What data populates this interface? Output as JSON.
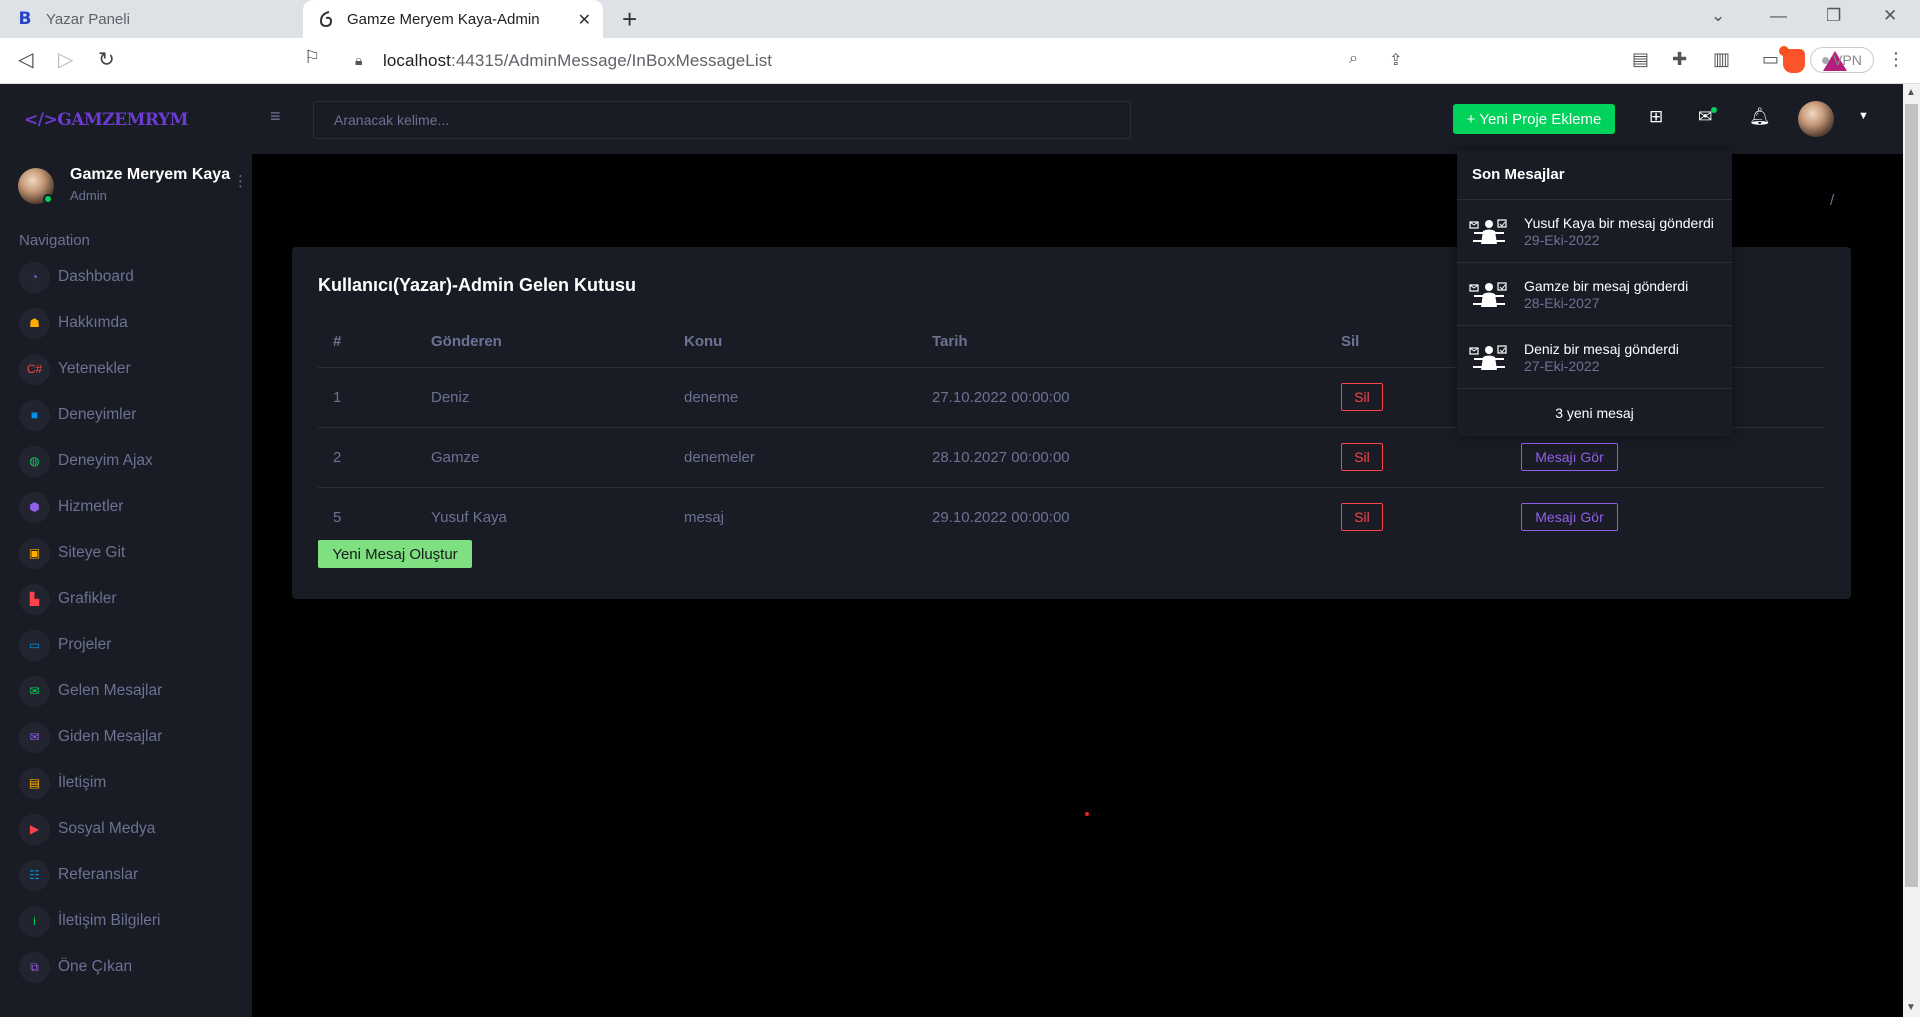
{
  "browser": {
    "tabs": [
      {
        "title": "Yazar Paneli",
        "active": false
      },
      {
        "title": "Gamze Meryem Kaya-Admin",
        "active": true
      }
    ],
    "url_host": "localhost",
    "url_rest": ":44315/AdminMessage/InBoxMessageList",
    "vpn_label": "VPN"
  },
  "sidebar": {
    "logo": "</>GAMZEMRYM",
    "profile": {
      "name": "Gamze Meryem Kaya",
      "role": "Admin"
    },
    "nav_title": "Navigation",
    "items": [
      {
        "label": "Dashboard",
        "icon": "speedometer-icon",
        "color": "#8f5fe8",
        "glyph": "◔"
      },
      {
        "label": "Hakkımda",
        "icon": "users-icon",
        "color": "#ffab00",
        "glyph": "☗"
      },
      {
        "label": "Yetenekler",
        "icon": "code-icon",
        "color": "#fc424a",
        "glyph": "C#"
      },
      {
        "label": "Deneyimler",
        "icon": "briefcase-icon",
        "color": "#0090e7",
        "glyph": "■"
      },
      {
        "label": "Deneyim Ajax",
        "icon": "globe-icon",
        "color": "#00d25b",
        "glyph": "◍"
      },
      {
        "label": "Hizmetler",
        "icon": "cube-icon",
        "color": "#8f5fe8",
        "glyph": "⬢"
      },
      {
        "label": "Siteye Git",
        "icon": "web-icon",
        "color": "#ffab00",
        "glyph": "▣"
      },
      {
        "label": "Grafikler",
        "icon": "chart-icon",
        "color": "#fc424a",
        "glyph": "▙"
      },
      {
        "label": "Projeler",
        "icon": "laptop-icon",
        "color": "#0090e7",
        "glyph": "▭"
      },
      {
        "label": "Gelen Mesajlar",
        "icon": "inbox-mail-icon",
        "color": "#00d25b",
        "glyph": "✉"
      },
      {
        "label": "Giden Mesajlar",
        "icon": "sent-mail-icon",
        "color": "#8f5fe8",
        "glyph": "✉"
      },
      {
        "label": "İletişim",
        "icon": "contact-card-icon",
        "color": "#ffab00",
        "glyph": "▤"
      },
      {
        "label": "Sosyal Medya",
        "icon": "youtube-icon",
        "color": "#fc424a",
        "glyph": "▶"
      },
      {
        "label": "Referanslar",
        "icon": "group-icon",
        "color": "#0090e7",
        "glyph": "☷"
      },
      {
        "label": "İletişim Bilgileri",
        "icon": "info-icon",
        "color": "#00d25b",
        "glyph": "i"
      },
      {
        "label": "Öne Çıkan",
        "icon": "featured-icon",
        "color": "#8f5fe8",
        "glyph": "⧉"
      }
    ]
  },
  "topbar": {
    "search_placeholder": "Aranacak kelime...",
    "new_project_label": "+ Yeni Proje Ekleme"
  },
  "breadcrumb_separator": "/",
  "card": {
    "title": "Kullanıcı(Yazar)-Admin Gelen Kutusu",
    "columns": [
      "#",
      "Gönderen",
      "Konu",
      "Tarih",
      "Sil",
      ""
    ],
    "rows": [
      {
        "id": "1",
        "sender": "Deniz",
        "subject": "deneme",
        "date": "27.10.2022 00:00:00",
        "delete_label": "Sil",
        "view_label": "Mesajı Gör"
      },
      {
        "id": "2",
        "sender": "Gamze",
        "subject": "denemeler",
        "date": "28.10.2027 00:00:00",
        "delete_label": "Sil",
        "view_label": "Mesajı Gör"
      },
      {
        "id": "5",
        "sender": "Yusuf Kaya",
        "subject": "mesaj",
        "date": "29.10.2022 00:00:00",
        "delete_label": "Sil",
        "view_label": "Mesajı Gör"
      }
    ],
    "new_message_label": "Yeni Mesaj Oluştur"
  },
  "messages_dropdown": {
    "title": "Son Mesajlar",
    "items": [
      {
        "text": "Yusuf Kaya bir mesaj gönderdi",
        "date": "29-Eki-2022"
      },
      {
        "text": "Gamze bir mesaj gönderdi",
        "date": "28-Eki-2027"
      },
      {
        "text": "Deniz bir mesaj gönderdi",
        "date": "27-Eki-2022"
      }
    ],
    "footer": "3 yeni mesaj"
  }
}
